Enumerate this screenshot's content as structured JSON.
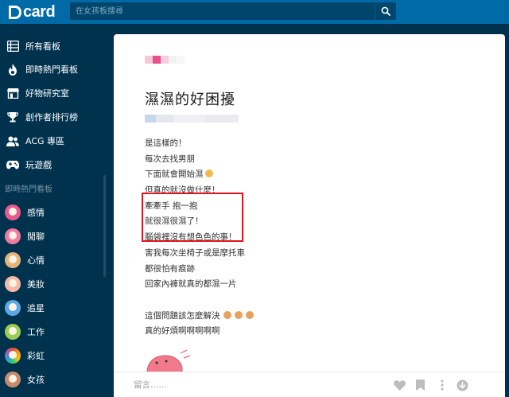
{
  "app": {
    "logo_text": "card",
    "brand_color": "#006aa6"
  },
  "search": {
    "placeholder": "在女孩板搜尋"
  },
  "sidebar": {
    "items": [
      {
        "label": "所有看板",
        "icon": "list-icon"
      },
      {
        "label": "即時熱門看板",
        "icon": "flame-icon"
      },
      {
        "label": "好物研究室",
        "icon": "store-icon"
      },
      {
        "label": "創作者排行榜",
        "icon": "trophy-icon"
      },
      {
        "label": "ACG 專區",
        "icon": "group-icon"
      },
      {
        "label": "玩遊戲",
        "icon": "gamepad-icon"
      }
    ],
    "section_title": "即時熱門看板",
    "boards": [
      {
        "label": "感情"
      },
      {
        "label": "閒聊"
      },
      {
        "label": "心情"
      },
      {
        "label": "美妝"
      },
      {
        "label": "追星"
      },
      {
        "label": "工作"
      },
      {
        "label": "彩虹"
      },
      {
        "label": "女孩"
      }
    ]
  },
  "post": {
    "title": "濕濕的好困擾",
    "lines": [
      "是這樣的！",
      "每次去找男朋",
      "下面就會開始濕",
      "但真的就沒做什麼！",
      "牽牽手 抱一抱",
      "就很濕很濕了！",
      "腦袋裡沒有想色色的事！",
      "害我每次坐椅子或是摩托車",
      "都很怕有痕跡",
      "回家內褲就真的都濕一片",
      "",
      "這個問題該怎麼解決",
      "真的好煩啊啊啊啊啊"
    ]
  },
  "bottombar": {
    "comment_placeholder": "留言……"
  },
  "colors": {
    "highlight_box": "#e0151d"
  }
}
